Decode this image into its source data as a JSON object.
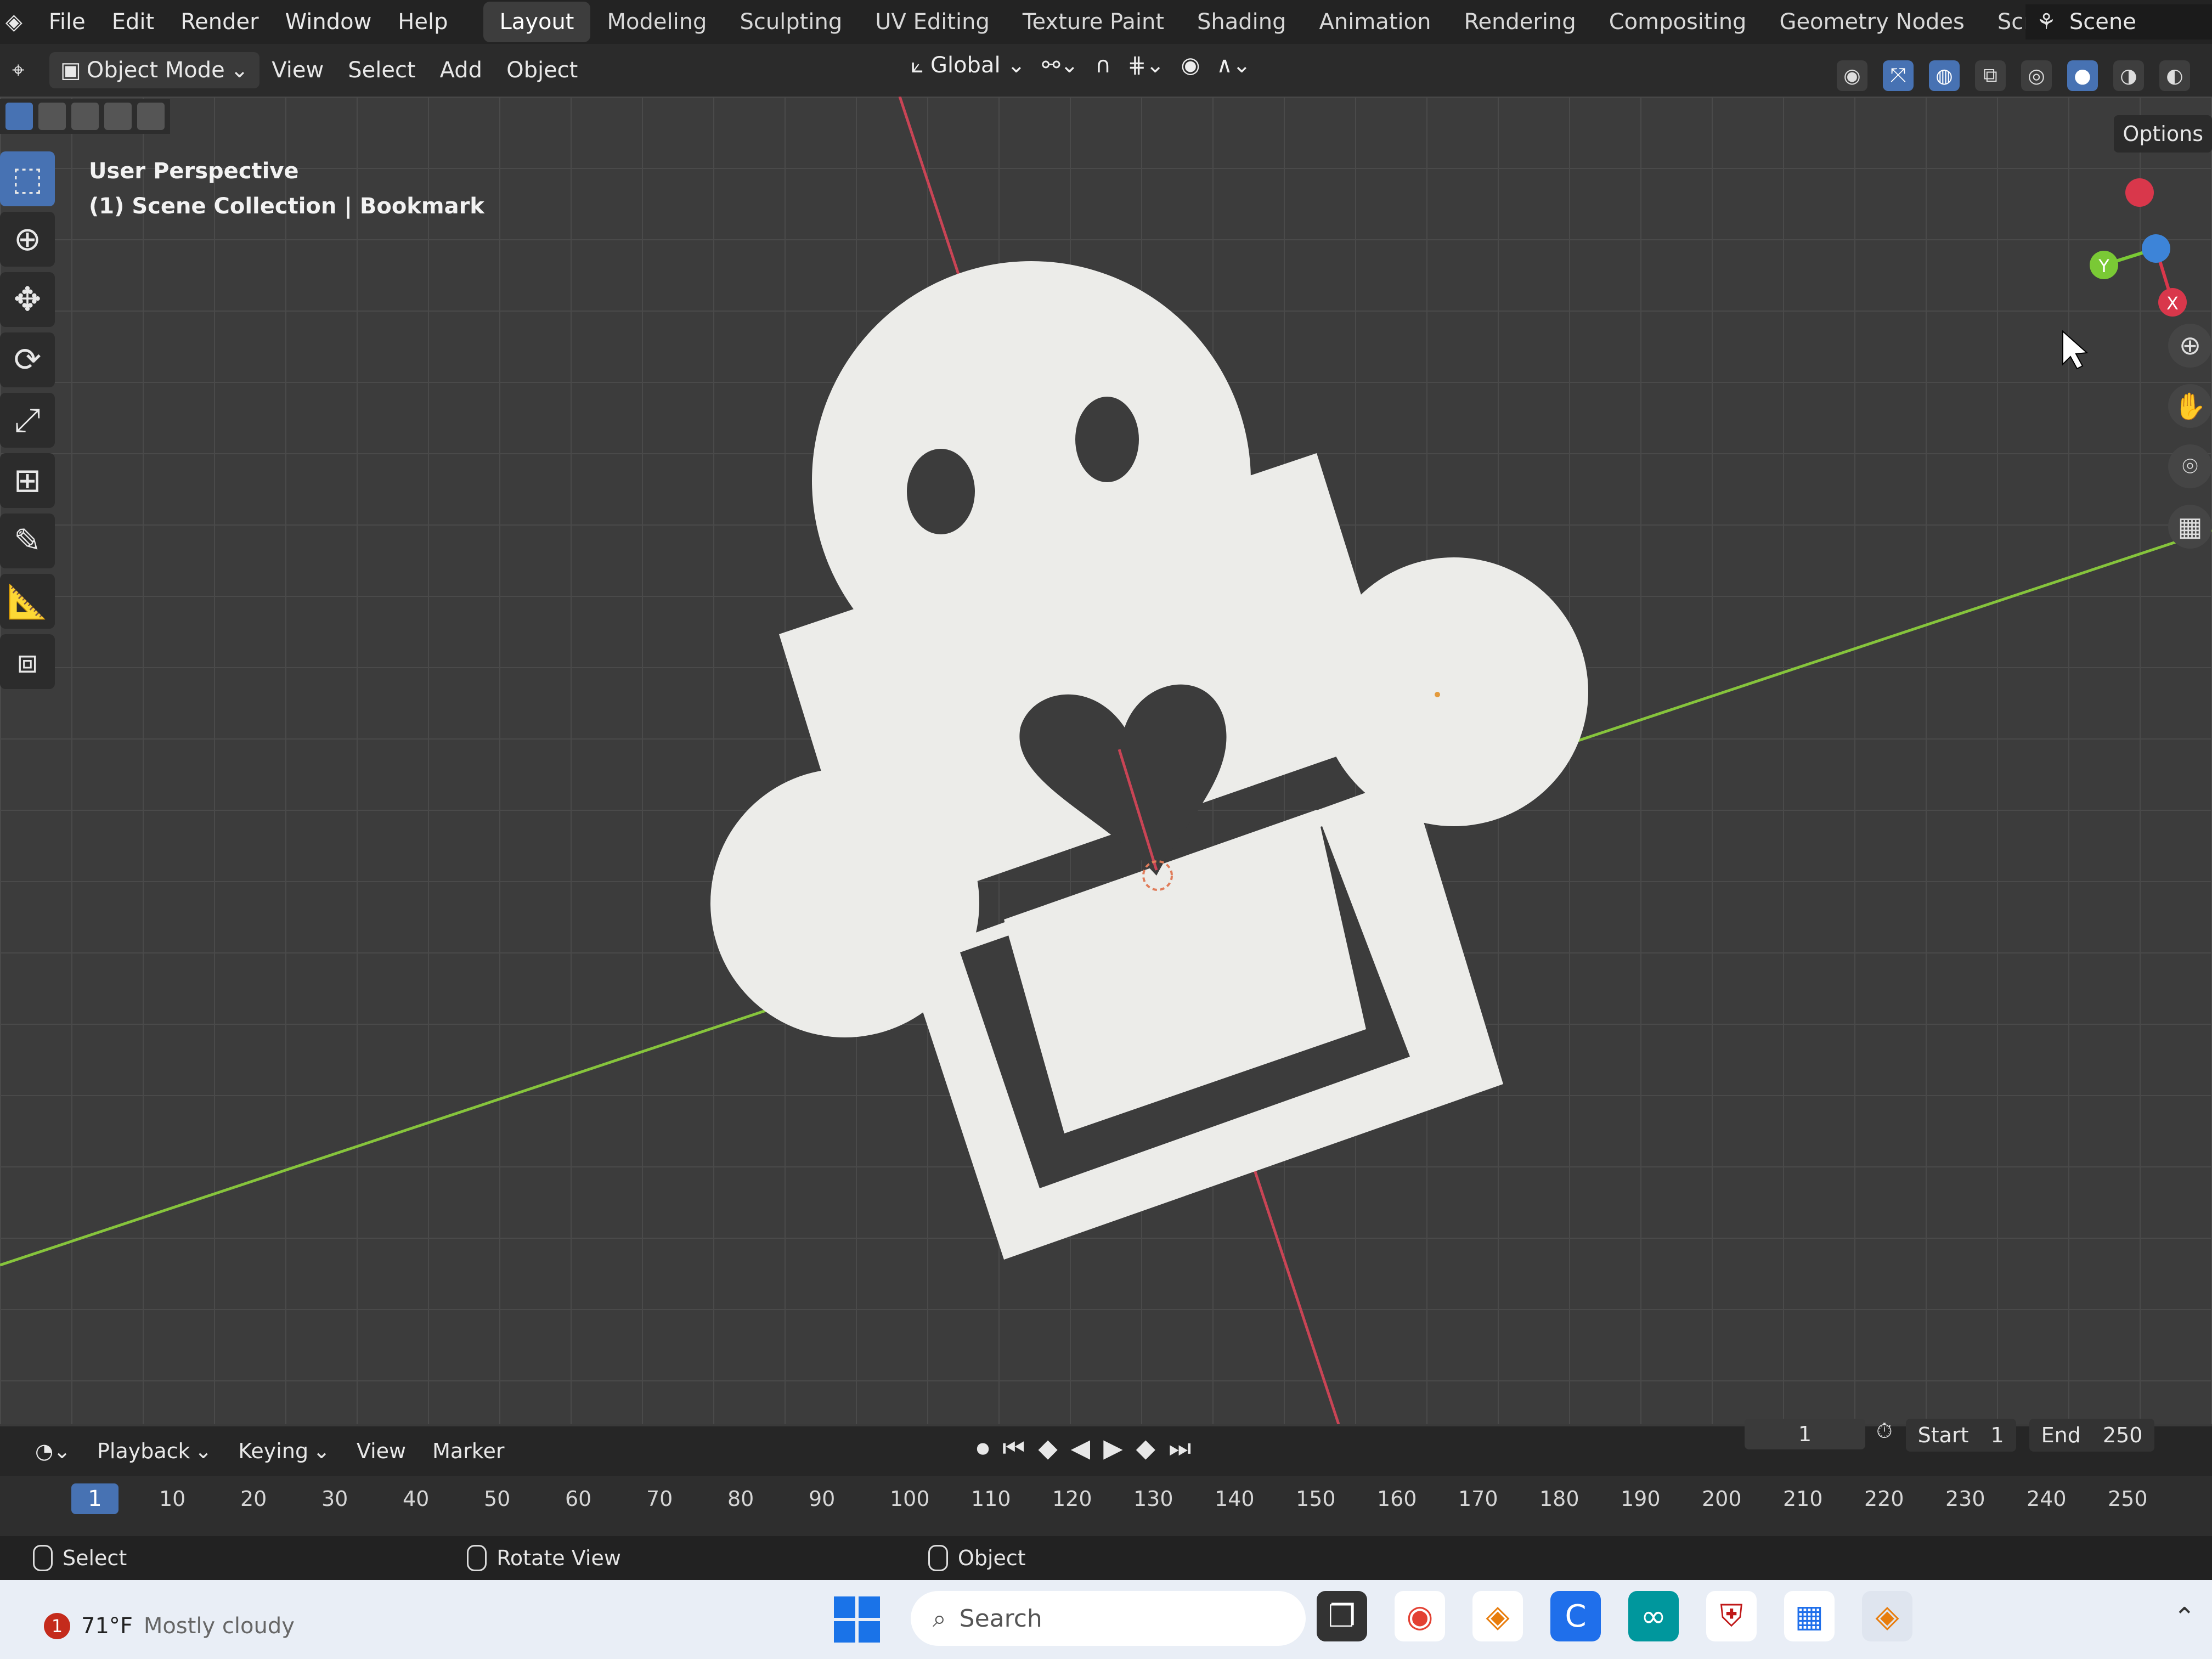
{
  "menu": [
    "File",
    "Edit",
    "Render",
    "Window",
    "Help"
  ],
  "workspaces": [
    "Layout",
    "Modeling",
    "Sculpting",
    "UV Editing",
    "Texture Paint",
    "Shading",
    "Animation",
    "Rendering",
    "Compositing",
    "Geometry Nodes",
    "Scripting"
  ],
  "active_workspace": "Layout",
  "scene_label": "Scene",
  "header": {
    "mode": "Object Mode",
    "menus": [
      "View",
      "Select",
      "Add",
      "Object"
    ],
    "transform_orientation": "Global"
  },
  "viewport": {
    "perspective_label": "User Perspective",
    "collection_label": "(1) Scene Collection | Bookmark",
    "options_label": "Options",
    "gizmo_axes": {
      "x": "X",
      "y": "Y"
    },
    "colors": {
      "x_axis": "#d9374b",
      "y_axis": "#7ac935",
      "z_axis": "#3d84d8",
      "object": "#ecece9"
    }
  },
  "timeline": {
    "menus": [
      "Playback",
      "Keying",
      "View",
      "Marker"
    ],
    "current_frame": "1",
    "start_label": "Start",
    "start_value": "1",
    "end_label": "End",
    "end_value": "250",
    "ruler_marks": [
      "10",
      "20",
      "30",
      "40",
      "50",
      "60",
      "70",
      "80",
      "90",
      "100",
      "110",
      "120",
      "130",
      "140",
      "150",
      "160",
      "170",
      "180",
      "190",
      "200",
      "210",
      "220",
      "230",
      "240",
      "250"
    ]
  },
  "status": {
    "left": "Select",
    "middle": "Rotate View",
    "right": "Object"
  },
  "taskbar": {
    "search_placeholder": "Search",
    "weather_temp": "71°F",
    "weather_desc": "Mostly cloudy",
    "notification_count": "1"
  }
}
